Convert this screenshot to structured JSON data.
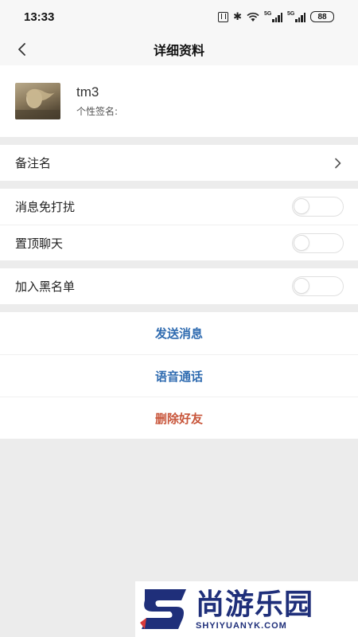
{
  "status_bar": {
    "time": "13:33",
    "signal_1_label": "5G",
    "signal_2_label": "5G",
    "battery": "88"
  },
  "nav": {
    "title": "详细资料",
    "back_icon": "chevron-left-icon"
  },
  "profile": {
    "name": "tm3",
    "signature_label": "个性签名:"
  },
  "remark_row": {
    "label": "备注名",
    "icon": "chevron-right-icon"
  },
  "settings": {
    "mute_label": "消息免打扰",
    "mute_on": false,
    "pin_label": "置顶聊天",
    "pin_on": false,
    "blacklist_label": "加入黑名单",
    "blacklist_on": false
  },
  "actions": {
    "send_message": "发送消息",
    "voice_call": "语音通话",
    "delete_friend": "删除好友"
  },
  "watermark": {
    "cn": "尚游乐园",
    "en": "SHYIYUANYK.COM"
  },
  "colors": {
    "action_blue": "#2f6bb0",
    "action_red": "#c8553a",
    "page_bg": "#ececec"
  }
}
